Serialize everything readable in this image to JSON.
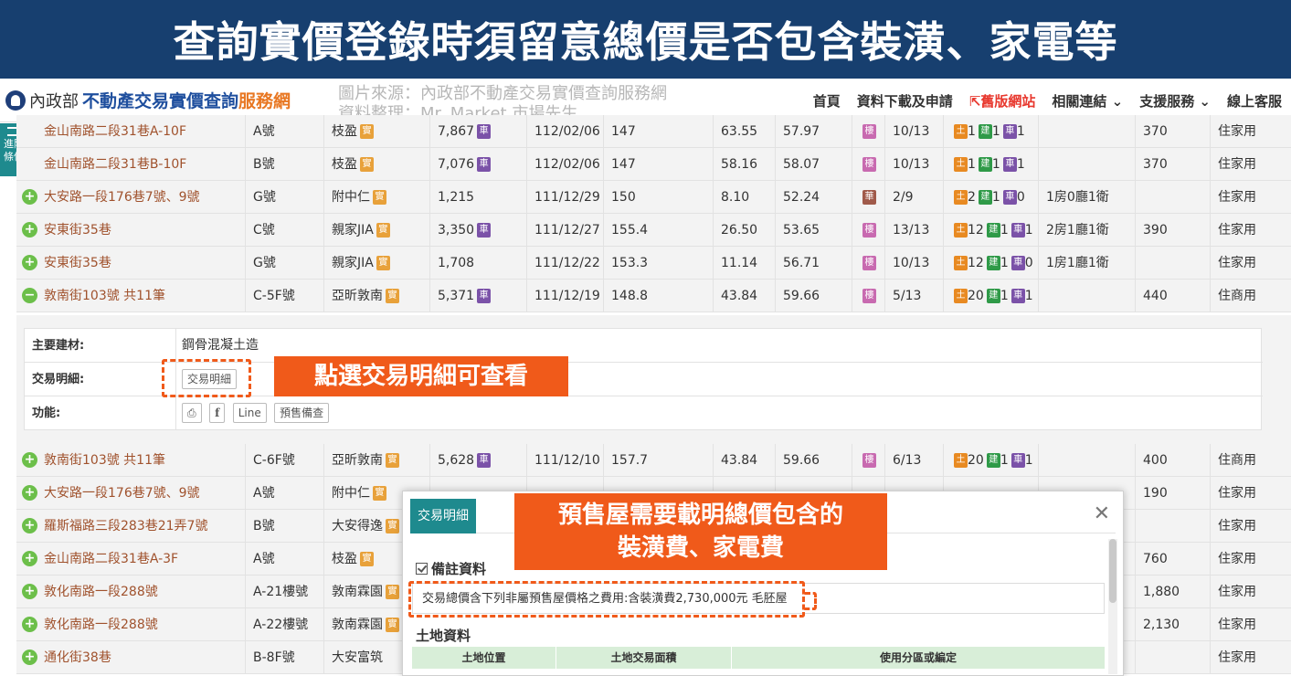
{
  "banner": {
    "title": "查詢實價登錄時須留意總價是否包含裝潢、家電等"
  },
  "nav": {
    "logo_agency": "內政部",
    "logo_main": "不動產交易實價查詢",
    "logo_service": "服務網",
    "source_line1": "圖片來源：內政部不動產交易實價查詢服務網",
    "source_line2": "資料整理：Mr. Market 市場先生",
    "links": [
      "首頁",
      "資料下載及申請",
      "⇱舊版網站",
      "相關連結 ⌄",
      "支援服務 ⌄",
      "線上客服"
    ]
  },
  "side": {
    "line1": "進階",
    "line2": "條件"
  },
  "rows_top": [
    {
      "addr": "金山南路二段31巷A-10F",
      "unit": "A號",
      "project": "枝盈",
      "ptag": "實",
      "price": "7,867",
      "ctag": "車",
      "date": "112/02/06",
      "unitprice": "147",
      "area": "63.55",
      "ratio": "57.97",
      "btag": "樓",
      "floor": "10/13",
      "land": "1",
      "build": "1",
      "car": "1",
      "layout": "",
      "park": "370",
      "use": "住家用",
      "icon": "none"
    },
    {
      "addr": "金山南路二段31巷B-10F",
      "unit": "B號",
      "project": "枝盈",
      "ptag": "實",
      "price": "7,076",
      "ctag": "車",
      "date": "112/02/06",
      "unitprice": "147",
      "area": "58.16",
      "ratio": "58.07",
      "btag": "樓",
      "floor": "10/13",
      "land": "1",
      "build": "1",
      "car": "1",
      "layout": "",
      "park": "370",
      "use": "住家用",
      "icon": "none"
    },
    {
      "addr": "大安路一段176巷7號、9號",
      "unit": "G號",
      "project": "附中仁",
      "ptag": "實",
      "price": "1,215",
      "ctag": "",
      "date": "111/12/29",
      "unitprice": "150",
      "area": "8.10",
      "ratio": "52.24",
      "btag": "華",
      "floor": "2/9",
      "land": "2",
      "build": "1",
      "car": "0",
      "layout": "1房0廳1衛",
      "park": "",
      "use": "住家用",
      "icon": "plus"
    },
    {
      "addr": "安東街35巷",
      "unit": "C號",
      "project": "親家JIA",
      "ptag": "實",
      "price": "3,350",
      "ctag": "車",
      "date": "111/12/27",
      "unitprice": "155.4",
      "area": "26.50",
      "ratio": "53.65",
      "btag": "樓",
      "floor": "13/13",
      "land": "12",
      "build": "1",
      "car": "1",
      "layout": "2房1廳1衛",
      "park": "390",
      "use": "住家用",
      "icon": "plus"
    },
    {
      "addr": "安東街35巷",
      "unit": "G號",
      "project": "親家JIA",
      "ptag": "實",
      "price": "1,708",
      "ctag": "",
      "date": "111/12/22",
      "unitprice": "153.3",
      "area": "11.14",
      "ratio": "56.71",
      "btag": "樓",
      "floor": "10/13",
      "land": "12",
      "build": "1",
      "car": "0",
      "layout": "1房1廳1衛",
      "park": "",
      "use": "住家用",
      "icon": "plus"
    },
    {
      "addr": "敦南街103號 共11筆",
      "unit": "C-5F號",
      "project": "亞昕敦南",
      "ptag": "實",
      "price": "5,371",
      "ctag": "車",
      "date": "111/12/19",
      "unitprice": "148.8",
      "area": "43.84",
      "ratio": "59.66",
      "btag": "樓",
      "floor": "5/13",
      "land": "20",
      "build": "1",
      "car": "1",
      "layout": "",
      "park": "440",
      "use": "住商用",
      "icon": "minus"
    }
  ],
  "detail": {
    "material_label": "主要建材:",
    "material_value": "鋼骨混凝土造",
    "trade_label": "交易明細:",
    "trade_button": "交易明細",
    "func_label": "功能:",
    "func_line": "Line",
    "func_presale": "預售備查",
    "callout1": "點選交易明細可查看"
  },
  "rows_bottom": [
    {
      "addr": "敦南街103號 共11筆",
      "unit": "C-6F號",
      "project": "亞昕敦南",
      "ptag": "實",
      "price": "5,628",
      "ctag": "車",
      "date": "111/12/10",
      "unitprice": "157.7",
      "area": "43.84",
      "ratio": "59.66",
      "btag": "樓",
      "floor": "6/13",
      "land": "20",
      "build": "1",
      "car": "1",
      "layout": "",
      "park": "400",
      "use": "住商用"
    },
    {
      "addr": "大安路一段176巷7號、9號",
      "unit": "A號",
      "project": "附中仁",
      "ptag": "實",
      "price": "",
      "ctag": "",
      "date": "",
      "unitprice": "",
      "area": "",
      "ratio": "",
      "btag": "",
      "floor": "",
      "land": "",
      "build": "",
      "car": "",
      "layout": "",
      "park": "190",
      "use": "住家用"
    },
    {
      "addr": "羅斯福路三段283巷21弄7號",
      "unit": "B號",
      "project": "大安得逸",
      "ptag": "實",
      "price": "",
      "ctag": "",
      "date": "",
      "unitprice": "",
      "area": "",
      "ratio": "",
      "btag": "",
      "floor": "",
      "land": "",
      "build": "",
      "car": "",
      "layout": "",
      "park": "",
      "use": "住家用"
    },
    {
      "addr": "金山南路二段31巷A-3F",
      "unit": "A號",
      "project": "枝盈",
      "ptag": "實",
      "price": "",
      "ctag": "",
      "date": "",
      "unitprice": "",
      "area": "",
      "ratio": "",
      "btag": "",
      "floor": "",
      "land": "",
      "build": "",
      "car": "",
      "layout": "",
      "park": "760",
      "use": "住家用"
    },
    {
      "addr": "敦化南路一段288號",
      "unit": "A-21樓號",
      "project": "敦南霖園",
      "ptag": "實",
      "price": "",
      "ctag": "",
      "date": "",
      "unitprice": "",
      "area": "",
      "ratio": "",
      "btag": "",
      "floor": "",
      "land": "",
      "build": "",
      "car": "",
      "layout": "",
      "park": "1,880",
      "use": "住家用"
    },
    {
      "addr": "敦化南路一段288號",
      "unit": "A-22樓號",
      "project": "敦南霖園",
      "ptag": "實",
      "price": "",
      "ctag": "",
      "date": "",
      "unitprice": "",
      "area": "",
      "ratio": "",
      "btag": "",
      "floor": "",
      "land": "",
      "build": "",
      "car": "",
      "layout": "",
      "park": "2,130",
      "use": "住家用"
    },
    {
      "addr": "通化街38巷",
      "unit": "B-8F號",
      "project": "大安富筑",
      "ptag": "",
      "price": "",
      "ctag": "",
      "date": "",
      "unitprice": "",
      "area": "",
      "ratio": "",
      "btag": "",
      "floor": "",
      "land": "",
      "build": "",
      "car": "",
      "layout": "",
      "park": "",
      "use": "住家用"
    }
  ],
  "modal": {
    "tab": "交易明細",
    "close": "✕",
    "remarks_title": "備註資料",
    "remarks_text": "交易總價含下列非屬預售屋價格之費用:含裝潢費2,730,000元 毛胚屋",
    "land_title": "土地資料",
    "land_cols": [
      "土地位置",
      "土地交易面積",
      "使用分區或編定"
    ],
    "callout2_line1": "預售屋需要載明總價包含的",
    "callout2_line2": "裝潢費、家電費"
  },
  "tag_labels": {
    "land": "土",
    "build": "建",
    "car": "車"
  },
  "colors": {
    "banner": "#173f6f",
    "accent": "#f05a1a",
    "teal": "#1e8a8e",
    "address": "#a0522d"
  }
}
